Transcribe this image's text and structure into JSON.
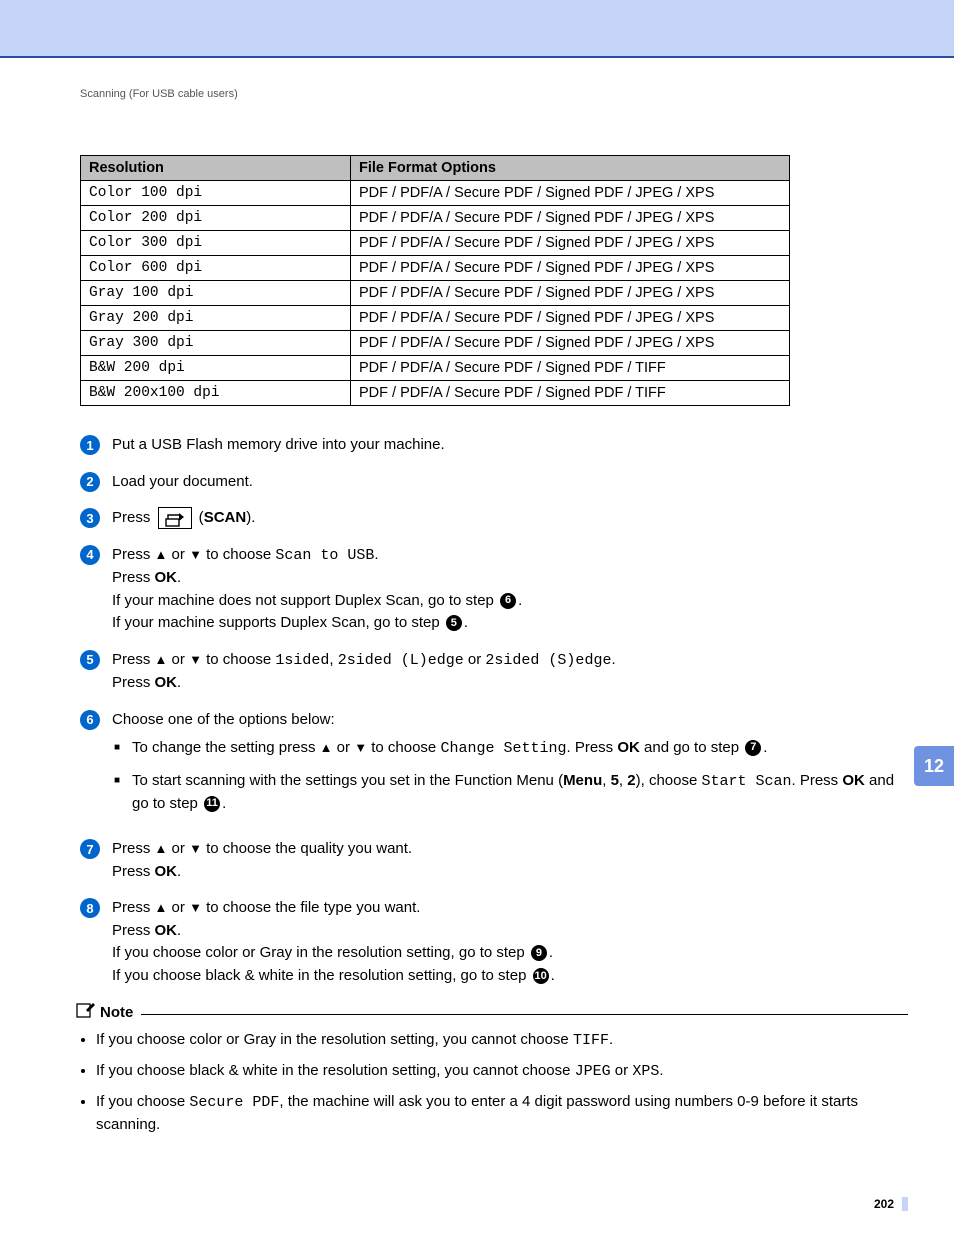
{
  "breadcrumb": "Scanning (For USB cable users)",
  "side_tab": "12",
  "page_number": "202",
  "table": {
    "headers": [
      "Resolution",
      "File Format Options"
    ],
    "rows": [
      [
        "Color 100 dpi",
        "PDF / PDF/A / Secure PDF / Signed PDF / JPEG / XPS"
      ],
      [
        "Color 200 dpi",
        "PDF / PDF/A / Secure PDF / Signed PDF / JPEG / XPS"
      ],
      [
        "Color 300 dpi",
        "PDF / PDF/A / Secure PDF / Signed PDF  / JPEG / XPS"
      ],
      [
        "Color 600 dpi",
        "PDF / PDF/A / Secure PDF / Signed PDF / JPEG / XPS"
      ],
      [
        "Gray 100 dpi",
        "PDF / PDF/A / Secure PDF / Signed PDF  / JPEG / XPS"
      ],
      [
        "Gray 200 dpi",
        "PDF / PDF/A / Secure PDF / Signed PDF  / JPEG / XPS"
      ],
      [
        "Gray 300 dpi",
        "PDF / PDF/A / Secure PDF / Signed PDF  / JPEG / XPS"
      ],
      [
        "B&W 200 dpi",
        "PDF / PDF/A / Secure PDF / Signed PDF / TIFF"
      ],
      [
        "B&W 200x100 dpi",
        "PDF / PDF/A / Secure PDF / Signed PDF  / TIFF"
      ]
    ]
  },
  "steps": {
    "s1": "Put a USB Flash memory drive into your machine.",
    "s2": "Load your document.",
    "s3_press": "Press",
    "s3_scan": "SCAN",
    "s4_l1a": "Press ",
    "s4_l1b": " or ",
    "s4_l1c": " to choose ",
    "s4_scan_to_usb": "Scan to USB",
    "s4_l2": "Press ",
    "s4_ok": "OK",
    "s4_l3": "If your machine does not support Duplex Scan, go to step ",
    "s4_l4": "If your machine supports Duplex Scan, go to step ",
    "s5_l1a": "Press ",
    "s5_l1b": " or ",
    "s5_l1c": " to choose ",
    "s5_opt1": "1sided",
    "s5_sep1": ", ",
    "s5_opt2": "2sided (L)edge",
    "s5_sep2": " or ",
    "s5_opt3": "2sided (S)edge",
    "s5_l2": "Press ",
    "s6_intro": "Choose one of the options below:",
    "s6_b1a": "To change the setting press ",
    "s6_b1b": " or ",
    "s6_b1c": " to choose ",
    "s6_change": "Change Setting",
    "s6_b1d": ". Press ",
    "s6_b1e": " and go to step ",
    "s6_b2a": "To start scanning with the settings you set in the Function Menu (",
    "s6_menu": "Menu",
    "s6_b2b": ", ",
    "s6_five": "5",
    "s6_b2c": ", ",
    "s6_two": "2",
    "s6_b2d": "), choose ",
    "s6_start": "Start Scan",
    "s6_b2e": ". Press ",
    "s6_b2f": " and go to step ",
    "s7_l1a": "Press ",
    "s7_l1b": " or ",
    "s7_l1c": " to choose the quality you want.",
    "s7_l2": "Press ",
    "s8_l1a": "Press ",
    "s8_l1b": " or ",
    "s8_l1c": " to choose the file type you want.",
    "s8_l2": "Press ",
    "s8_l3": "If you choose color or Gray in the resolution setting, go to step ",
    "s8_l4": "If you choose black & white in the resolution setting, go to step "
  },
  "note": {
    "title": "Note",
    "n1a": "If you choose color or Gray in the resolution setting, you cannot choose ",
    "n1_tiff": "TIFF",
    "n2a": "If you choose black & white in the resolution setting, you cannot choose ",
    "n2_jpeg": "JPEG",
    "n2_or": " or ",
    "n2_xps": "XPS",
    "n3a": "If you choose ",
    "n3_sec": "Secure PDF",
    "n3b": ", the machine will ask you to enter a 4 digit password using numbers 0-9 before it starts scanning."
  },
  "inline_refs": {
    "r5": "5",
    "r6": "6",
    "r7": "7",
    "r9": "9",
    "r10": "10",
    "r11": "11"
  }
}
